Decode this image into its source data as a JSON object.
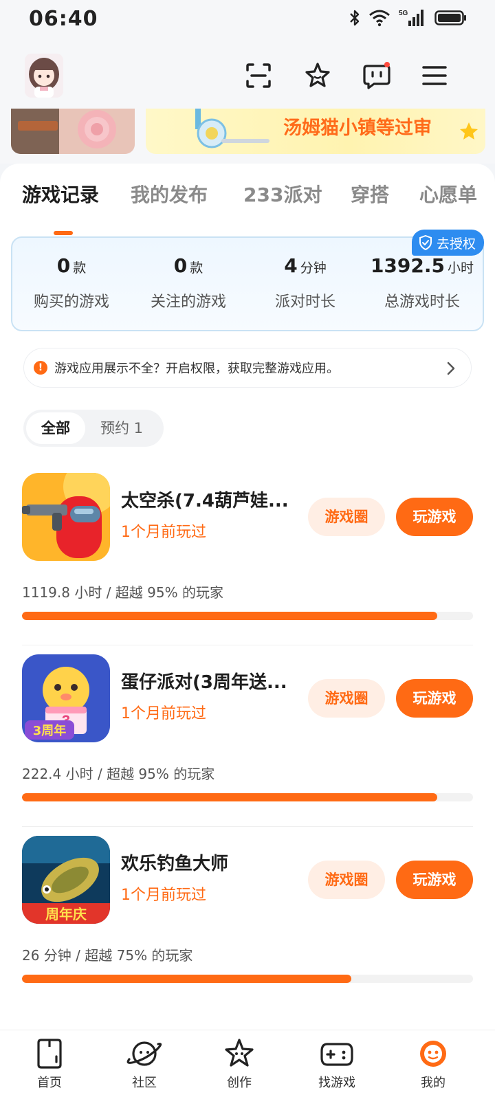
{
  "status": {
    "time": "06:40",
    "network": "5G"
  },
  "banner": {
    "text": "汤姆猫小镇等过审"
  },
  "tabs": [
    "游戏记录",
    "我的发布",
    "233派对",
    "穿搭",
    "心愿单"
  ],
  "auth_badge": "去授权",
  "stats": [
    {
      "value": "0",
      "unit": "款",
      "label": "购买的游戏"
    },
    {
      "value": "0",
      "unit": "款",
      "label": "关注的游戏"
    },
    {
      "value": "4",
      "unit": "分钟",
      "label": "派对时长"
    },
    {
      "value": "1392.5",
      "unit": "小时",
      "label": "总游戏时长"
    }
  ],
  "notice": {
    "text": "游戏应用展示不全？开启权限，获取完整游戏应用。"
  },
  "filters": {
    "all": "全部",
    "reserve": "预约 1"
  },
  "buttons": {
    "circle": "游戏圈",
    "play": "玩游戏"
  },
  "games": [
    {
      "title": "太空杀(7.4葫芦娃...",
      "last_played": "1个月前玩过",
      "stat": "1119.8 小时 / 超越 95% 的玩家",
      "progress": 0.92
    },
    {
      "title": "蛋仔派对(3周年送...",
      "last_played": "1个月前玩过",
      "stat": "222.4 小时 / 超越 95% 的玩家",
      "progress": 0.92
    },
    {
      "title": "欢乐钓鱼大师",
      "last_played": "1个月前玩过",
      "stat": "26 分钟 / 超越 75% 的玩家",
      "progress": 0.73
    }
  ],
  "game_icon_text": {
    "eggy_badge": "3周年",
    "fish_badge": "周年庆"
  },
  "bottom_nav": [
    "首页",
    "社区",
    "创作",
    "找游戏",
    "我的"
  ],
  "colors": {
    "accent": "#ff6a14",
    "badge_blue": "#2d8cf0"
  }
}
